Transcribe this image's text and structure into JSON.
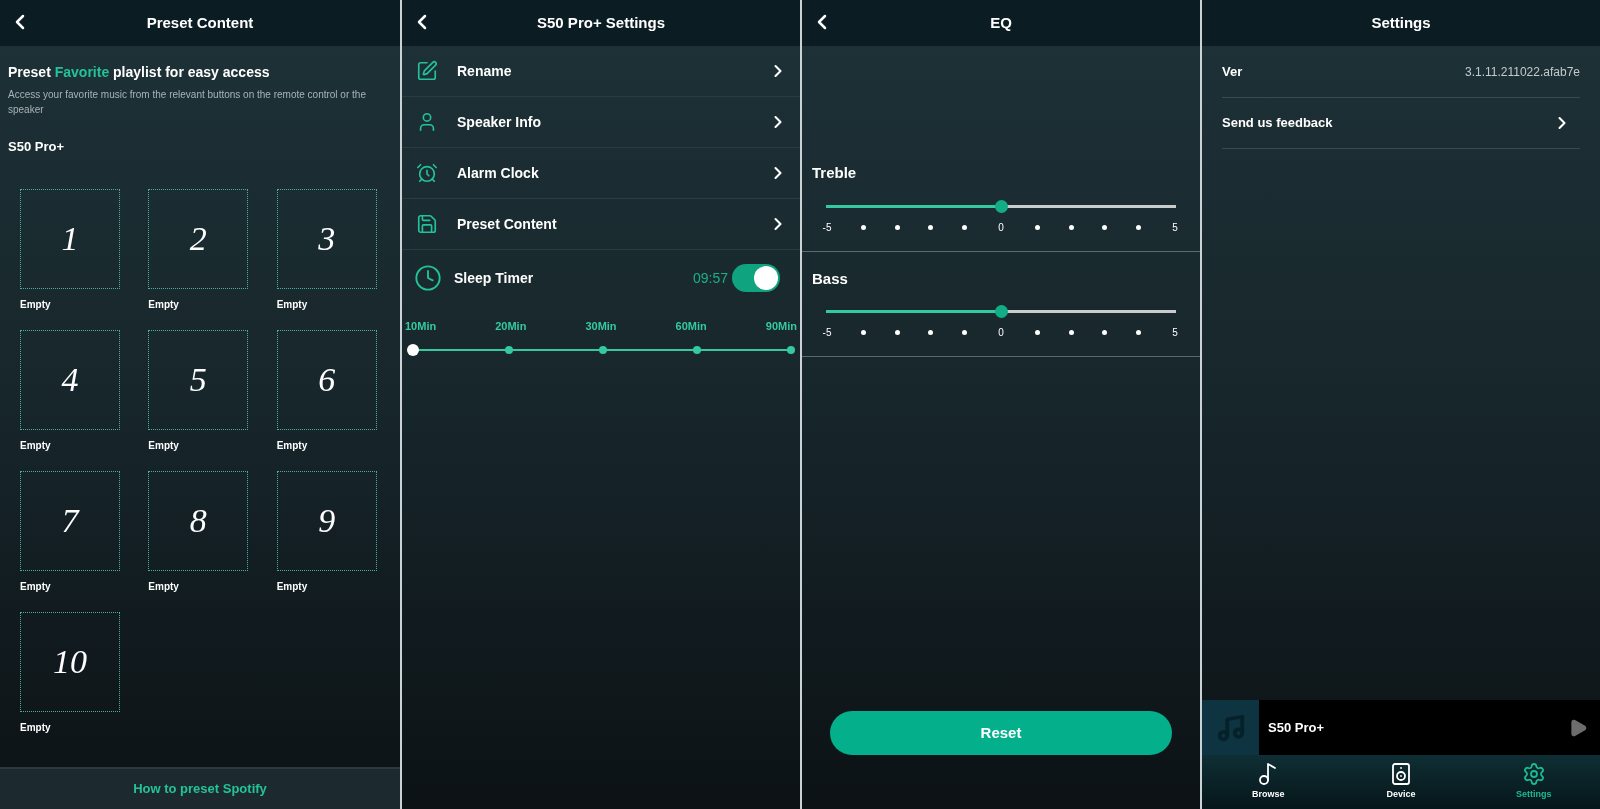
{
  "preset_screen": {
    "title": "Preset Content",
    "heading": [
      {
        "text": "Preset ",
        "highlight": false
      },
      {
        "text": "Favorite",
        "highlight": true
      },
      {
        "text": " playlist for easy access",
        "highlight": false
      }
    ],
    "description": "Access your favorite music from the relevant buttons on the remote control or the speaker",
    "device_name": "S50 Pro+",
    "presets": [
      {
        "number": "1",
        "label": "Empty"
      },
      {
        "number": "2",
        "label": "Empty"
      },
      {
        "number": "3",
        "label": "Empty"
      },
      {
        "number": "4",
        "label": "Empty"
      },
      {
        "number": "5",
        "label": "Empty"
      },
      {
        "number": "6",
        "label": "Empty"
      },
      {
        "number": "7",
        "label": "Empty"
      },
      {
        "number": "8",
        "label": "Empty"
      },
      {
        "number": "9",
        "label": "Empty"
      },
      {
        "number": "10",
        "label": "Empty"
      }
    ],
    "footer_link": "How to preset Spotify"
  },
  "speaker_settings": {
    "title": "S50 Pro+ Settings",
    "menu": [
      {
        "label": "Rename",
        "kind": "rename"
      },
      {
        "label": "Speaker Info",
        "kind": "info"
      },
      {
        "label": "Alarm Clock",
        "kind": "alarm"
      },
      {
        "label": "Preset Content",
        "kind": "preset"
      }
    ],
    "sleep_timer": {
      "label": "Sleep Timer",
      "time": "09:57",
      "on": true
    },
    "timer_options": [
      {
        "label": "10Min",
        "selected": true
      },
      {
        "label": "20Min",
        "selected": false
      },
      {
        "label": "30Min",
        "selected": false
      },
      {
        "label": "60Min",
        "selected": false
      },
      {
        "label": "90Min",
        "selected": false
      }
    ]
  },
  "eq": {
    "title": "EQ",
    "bands": [
      {
        "name": "Treble",
        "level": 0.5,
        "ticks": [
          "-5",
          "0",
          "5"
        ]
      },
      {
        "name": "Bass",
        "level": 0.5,
        "ticks": [
          "-5",
          "0",
          "5"
        ]
      }
    ],
    "reset_button": "Reset"
  },
  "app_settings": {
    "title": "Settings",
    "version_label": "Ver",
    "version_value": "3.1.11.211022.afab7e",
    "feedback": "Send us feedback",
    "now_playing": {
      "title": "S50 Pro+"
    },
    "tabs": [
      {
        "label": "Browse",
        "kind": "browse",
        "selected": false
      },
      {
        "label": "Device",
        "kind": "device",
        "selected": false
      },
      {
        "label": "Settings",
        "kind": "settings",
        "selected": true
      }
    ]
  }
}
